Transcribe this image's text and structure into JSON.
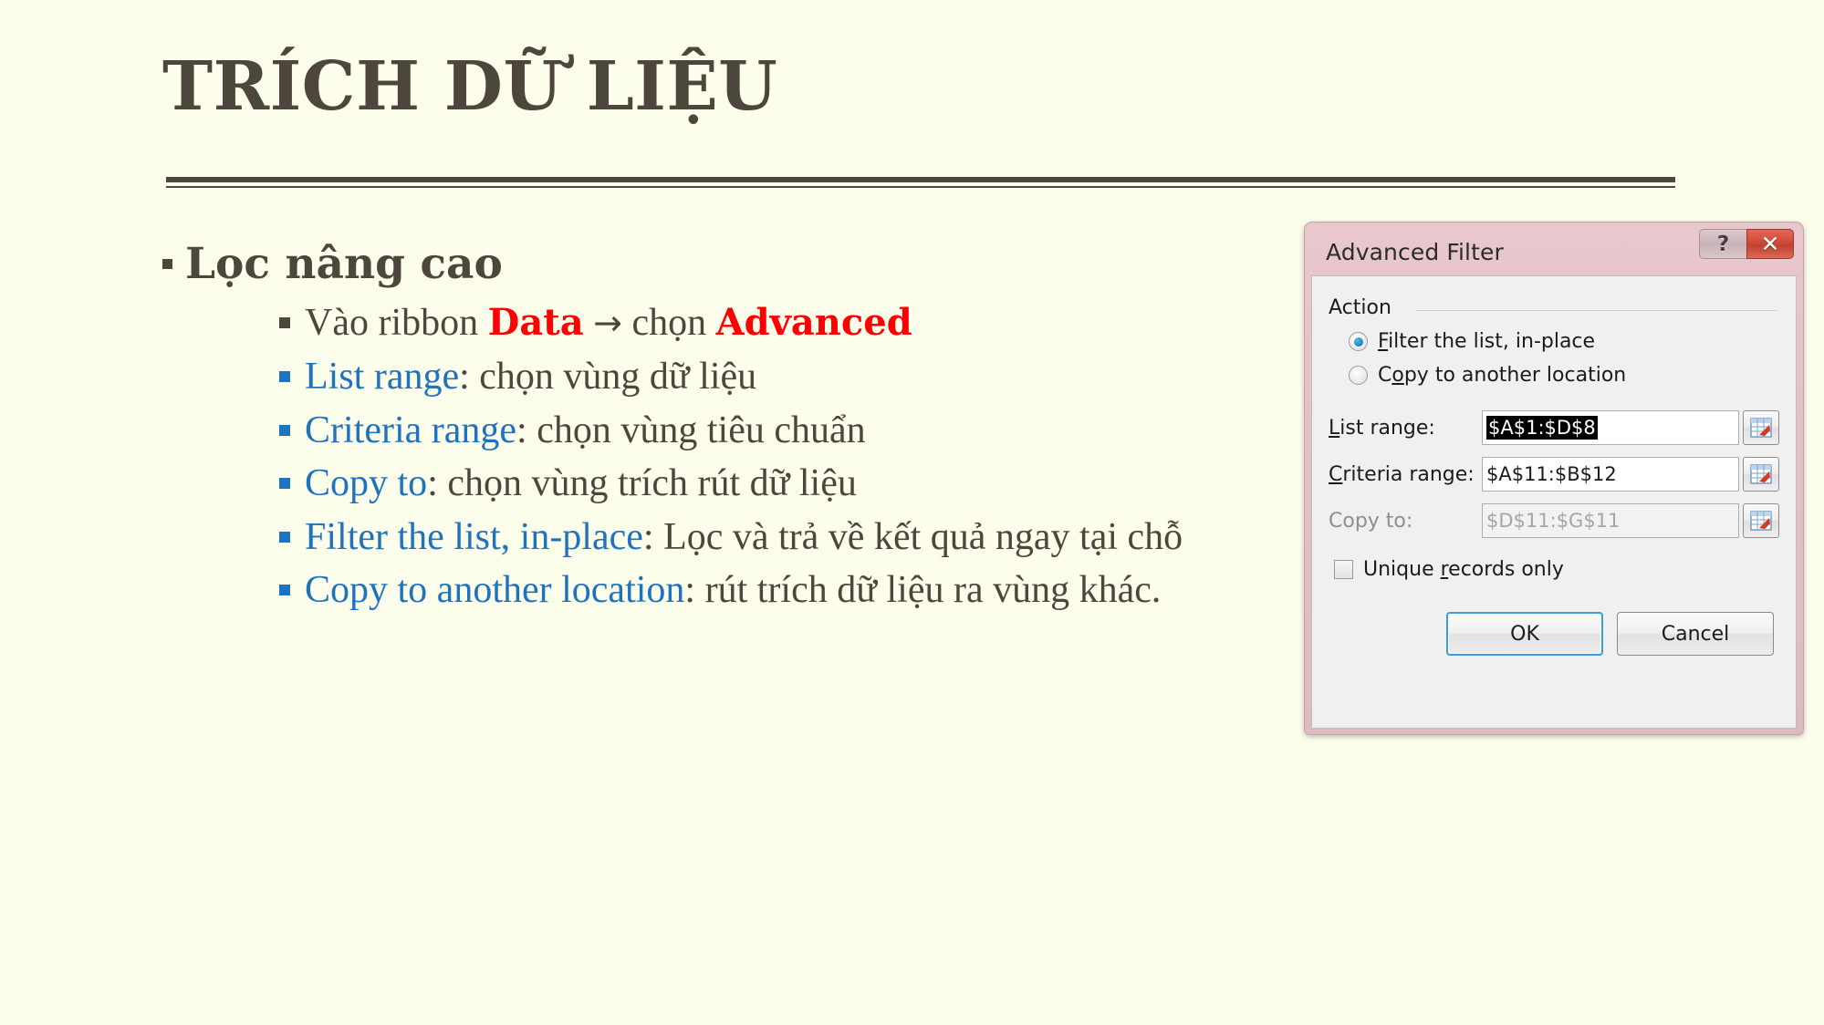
{
  "slide": {
    "background_color": "#FDFDEB",
    "title": "TRÍCH DỮ LIỆU",
    "title_color": "#4D463D"
  },
  "body": {
    "level1_bullet": "Lọc nâng cao",
    "sub_bullets": [
      {
        "bullet_color": "#4D463D",
        "segments": [
          {
            "text": "Vào ribbon ",
            "style": "normal"
          },
          {
            "text": "Data",
            "style": "bold-red"
          },
          {
            "text": " ",
            "style": "normal"
          },
          {
            "text": "→",
            "style": "arrow"
          },
          {
            "text": " chọn ",
            "style": "normal"
          },
          {
            "text": "Advanced",
            "style": "bold-red"
          }
        ]
      },
      {
        "bullet_color": "#1F72BE",
        "segments": [
          {
            "text": "List range",
            "style": "blue"
          },
          {
            "text": ": chọn vùng dữ liệu",
            "style": "normal"
          }
        ]
      },
      {
        "bullet_color": "#1F72BE",
        "segments": [
          {
            "text": "Criteria range",
            "style": "blue"
          },
          {
            "text": ": chọn vùng tiêu chuẩn",
            "style": "normal"
          }
        ]
      },
      {
        "bullet_color": "#1F72BE",
        "segments": [
          {
            "text": "Copy to",
            "style": "blue"
          },
          {
            "text": ": chọn vùng trích rút dữ liệu",
            "style": "normal"
          }
        ]
      },
      {
        "bullet_color": "#1F72BE",
        "segments": [
          {
            "text": "Filter the list, in-place",
            "style": "blue"
          },
          {
            "text": ": Lọc và trả về kết quả ngay tại chỗ",
            "style": "normal"
          }
        ]
      },
      {
        "bullet_color": "#1F72BE",
        "segments": [
          {
            "text": "Copy to another location",
            "style": "blue"
          },
          {
            "text": ": rút trích dữ liệu ra vùng khác.",
            "style": "normal"
          }
        ]
      }
    ],
    "accent_red": "#FF0000",
    "accent_blue": "#1F72BE"
  },
  "dialog": {
    "title": "Advanced Filter",
    "help_button": "?",
    "close_button": "✕",
    "action_group_label": "Action",
    "radios": [
      {
        "label_prefix": "F",
        "label_rest": "ilter the list, in-place",
        "checked": true
      },
      {
        "label_prefix": "",
        "label_mid": "C",
        "label_accel": "o",
        "label_rest": "py to another location",
        "checked": false
      }
    ],
    "radio_filter_label": "Filter the list, in-place",
    "radio_copy_label": "Copy to another location",
    "fields": [
      {
        "label": "List range:",
        "value": "$A$1:$D$8",
        "disabled": false,
        "selected": true
      },
      {
        "label": "Criteria range:",
        "value": "$A$11:$B$12",
        "disabled": false,
        "selected": false
      },
      {
        "label": "Copy to:",
        "value": "$D$11:$G$11",
        "disabled": true,
        "selected": false
      }
    ],
    "checkbox": {
      "label": "Unique records only",
      "checked": false
    },
    "buttons": {
      "ok": "OK",
      "cancel": "Cancel"
    },
    "titlebar_color": "#E3C2C7",
    "close_button_color": "#D04A36"
  }
}
